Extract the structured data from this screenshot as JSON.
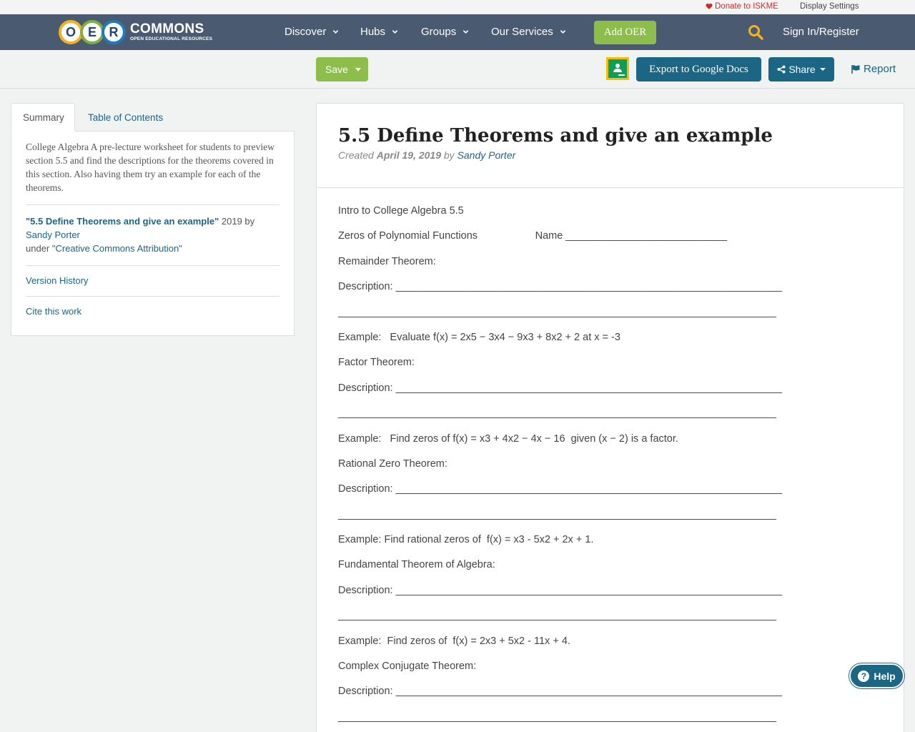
{
  "utility": {
    "donate": "Donate to ISKME",
    "display_settings": "Display Settings"
  },
  "logo": {
    "letters": [
      "O",
      "E",
      "R"
    ],
    "wordmark": "COMMONS",
    "tagline": "OPEN EDUCATIONAL RESOURCES"
  },
  "nav": {
    "items": [
      "Discover",
      "Hubs",
      "Groups",
      "Our Services"
    ],
    "add_oer": "Add OER",
    "sign_in": "Sign In/Register"
  },
  "actions": {
    "save": "Save",
    "export": "Export to Google Docs",
    "share": "Share",
    "report": "Report"
  },
  "tabs": {
    "summary": "Summary",
    "toc": "Table of Contents"
  },
  "sidebar": {
    "summary": "College Algebra A pre-lecture worksheet for students to preview section 5.5 and find the descriptions for the theorems covered in this section. Also having them try an example for each of the theorems.",
    "work_title": "\"5.5 Define Theorems and give an example\"",
    "year_by": " 2019 by",
    "author": "Sandy Porter",
    "under": "under ",
    "license": "\"Creative Commons Attribution\"",
    "version_history": "Version History",
    "cite": "Cite this work"
  },
  "document": {
    "title": "5.5 Define Theorems and give an example",
    "created_label": "Created ",
    "date": "April 19, 2019",
    "by_label": " by ",
    "author": "Sandy Porter",
    "lines": [
      "Intro to College Algebra 5.5",
      "Zeros of Polynomial Functions                    Name ____________________________",
      "Remainder Theorem:",
      "Description: ___________________________________________________________________",
      "____________________________________________________________________________",
      "Example:   Evaluate f(x) = 2x5 − 3x4 − 9x3 + 8x2 + 2 at x = -3",
      "Factor Theorem:",
      "Description: ___________________________________________________________________",
      "____________________________________________________________________________",
      "Example:   Find zeros of f(x) = x3 + 4x2 − 4x − 16  given (x − 2) is a factor.",
      "Rational Zero Theorem:",
      "Description: ___________________________________________________________________",
      "____________________________________________________________________________",
      "Example: Find rational zeros of  f(x) = x3 - 5x2 + 2x + 1.",
      "Fundamental Theorem of Algebra:",
      "Description: ___________________________________________________________________",
      "____________________________________________________________________________",
      "Example:  Find zeros of  f(x) = 2x3 + 5x2 - 11x + 4.",
      "Complex Conjugate Theorem:",
      "Description: ___________________________________________________________________",
      "____________________________________________________________________________"
    ]
  },
  "help": {
    "label": "Help",
    "glyph": "?"
  },
  "colors": {
    "navbar": "#4a5a70",
    "green": "#8dbd4b",
    "teal": "#1b6585",
    "donate_red": "#cf2a2a"
  }
}
